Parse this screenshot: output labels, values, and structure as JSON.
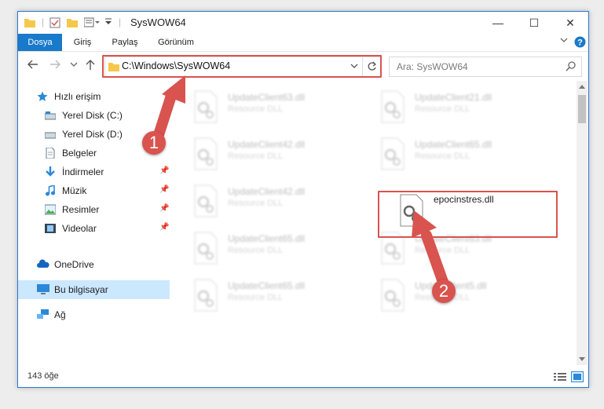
{
  "window": {
    "title": "SysWOW64"
  },
  "window_controls": {
    "minimize": "—",
    "maximize": "☐",
    "close": "✕"
  },
  "ribbon": {
    "tabs": [
      "Dosya",
      "Giriş",
      "Paylaş",
      "Görünüm"
    ]
  },
  "address": {
    "path": "C:\\Windows\\SysWOW64"
  },
  "search": {
    "placeholder": "Ara: SysWOW64"
  },
  "sidebar": {
    "items": [
      {
        "label": "Hızlı erişim",
        "icon": "star-icon"
      },
      {
        "label": "Yerel Disk (C:)",
        "icon": "drive-icon"
      },
      {
        "label": "Yerel Disk (D:)",
        "icon": "drive-icon"
      },
      {
        "label": "Belgeler",
        "icon": "document-icon"
      },
      {
        "label": "İndirmeler",
        "icon": "download-icon"
      },
      {
        "label": "Müzik",
        "icon": "music-icon"
      },
      {
        "label": "Resimler",
        "icon": "pictures-icon"
      },
      {
        "label": "Videolar",
        "icon": "video-icon"
      },
      {
        "label": "OneDrive",
        "icon": "cloud-icon"
      },
      {
        "label": "Bu bilgisayar",
        "icon": "computer-icon"
      },
      {
        "label": "Ağ",
        "icon": "network-icon"
      }
    ]
  },
  "files": [
    {
      "name": "UpdateClient63.dll",
      "type": "Resource DLL"
    },
    {
      "name": "UpdateClient21.dll",
      "type": "Resource DLL"
    },
    {
      "name": "UpdateClient42.dll",
      "type": "Resource DLL"
    },
    {
      "name": "UpdateClient65.dll",
      "type": "Resource DLL"
    },
    {
      "name": "UpdateClient42.dll",
      "type": "Resource DLL"
    },
    {
      "name": "epocinstres.dll",
      "type": ""
    },
    {
      "name": "UpdateClient65.dll",
      "type": "Resource DLL"
    },
    {
      "name": "UpdateClient63.dll",
      "type": "Resource DLL"
    },
    {
      "name": "UpdateClient65.dll",
      "type": "Resource DLL"
    },
    {
      "name": "UpdateClient5.dll",
      "type": "Resource DLL"
    }
  ],
  "status": {
    "count": "143 öğe"
  },
  "annotations": {
    "step1": "1",
    "step2": "2"
  },
  "colors": {
    "accent": "#1979ca",
    "highlight": "#d9534f",
    "selected": "#cce8ff"
  }
}
